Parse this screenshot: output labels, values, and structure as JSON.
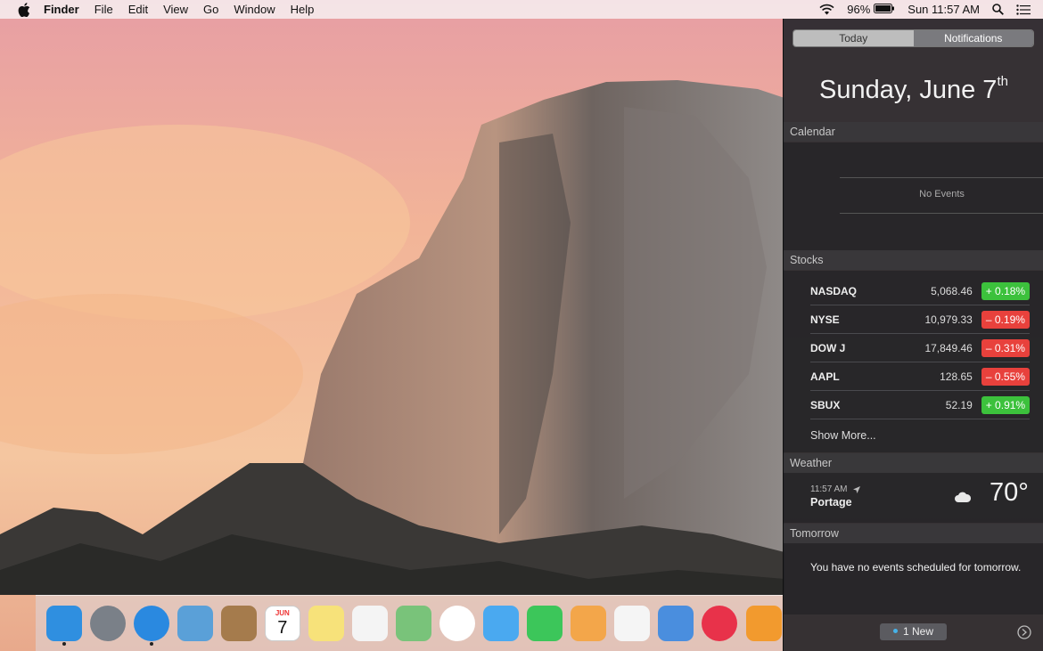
{
  "menubar": {
    "app_name": "Finder",
    "menus": [
      "File",
      "Edit",
      "View",
      "Go",
      "Window",
      "Help"
    ],
    "battery_percent": "96%",
    "clock": "Sun 11:57 AM",
    "icons": [
      "apple-icon",
      "wifi-icon",
      "battery-icon",
      "spotlight-search-icon",
      "notification-center-icon"
    ]
  },
  "notification_center": {
    "tabs": {
      "today": "Today",
      "notifications": "Notifications"
    },
    "date": {
      "text": "Sunday, June 7",
      "suffix": "th"
    },
    "calendar": {
      "header": "Calendar",
      "empty": "No Events"
    },
    "stocks": {
      "header": "Stocks",
      "rows": [
        {
          "symbol": "NASDAQ",
          "price": "5,068.46",
          "change": "+ 0.18%",
          "direction": "up"
        },
        {
          "symbol": "NYSE",
          "price": "10,979.33",
          "change": "– 0.19%",
          "direction": "down"
        },
        {
          "symbol": "DOW J",
          "price": "17,849.46",
          "change": "– 0.31%",
          "direction": "down"
        },
        {
          "symbol": "AAPL",
          "price": "128.65",
          "change": "– 0.55%",
          "direction": "down"
        },
        {
          "symbol": "SBUX",
          "price": "52.19",
          "change": "+ 0.91%",
          "direction": "up"
        }
      ],
      "show_more": "Show More..."
    },
    "weather": {
      "header": "Weather",
      "time": "11:57 AM",
      "location": "Portage",
      "temperature": "70°",
      "condition_icon": "cloud-icon"
    },
    "tomorrow": {
      "header": "Tomorrow",
      "text": "You have no events scheduled for tomorrow."
    },
    "footer": {
      "new_badge": "1 New"
    }
  },
  "dock": {
    "items": [
      {
        "name": "finder",
        "color": "#2f8fe0",
        "running": true
      },
      {
        "name": "launchpad",
        "color": "#7a8088",
        "running": false
      },
      {
        "name": "safari",
        "color": "#2a89e0",
        "running": true
      },
      {
        "name": "mail",
        "color": "#5aa0d8",
        "running": false
      },
      {
        "name": "contacts",
        "color": "#a57b4c",
        "running": false
      },
      {
        "name": "calendar",
        "color": "#ffffff",
        "running": false,
        "month": "JUN",
        "day": "7"
      },
      {
        "name": "notes",
        "color": "#f7e27a",
        "running": false
      },
      {
        "name": "reminders",
        "color": "#f4f4f4",
        "running": false
      },
      {
        "name": "maps",
        "color": "#79c37a",
        "running": false
      },
      {
        "name": "photos",
        "color": "#ffffff",
        "running": false
      },
      {
        "name": "messages",
        "color": "#4aa9f0",
        "running": false
      },
      {
        "name": "facetime",
        "color": "#3cc65a",
        "running": false
      },
      {
        "name": "pages",
        "color": "#f3a64a",
        "running": false
      },
      {
        "name": "numbers",
        "color": "#f5f5f5",
        "running": false
      },
      {
        "name": "keynote",
        "color": "#4a8ede",
        "running": false
      },
      {
        "name": "itunes",
        "color": "#e8324a",
        "running": false
      },
      {
        "name": "ibooks",
        "color": "#f29a2e",
        "running": false
      }
    ]
  },
  "colors": {
    "stock_up": "#3cc13c",
    "stock_down": "#e8413c",
    "accent_blue": "#46b2e8"
  }
}
